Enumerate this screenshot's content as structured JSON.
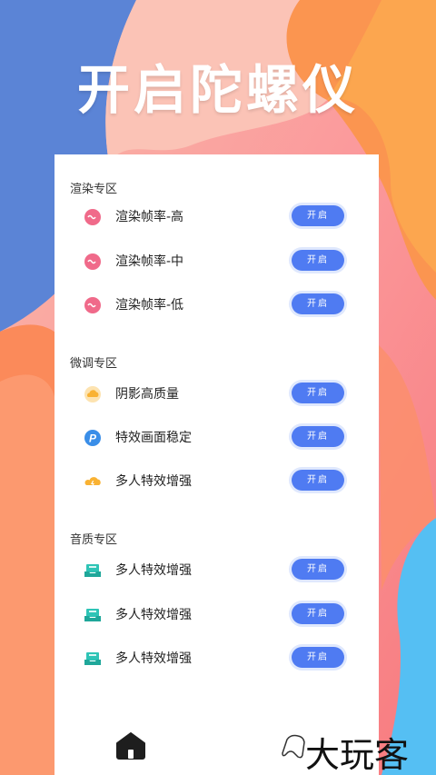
{
  "header": {
    "title": "开启陀螺仪"
  },
  "sections": [
    {
      "title": "渲染专区",
      "items": [
        {
          "label": "渲染帧率-高",
          "icon": "pink-badge-icon",
          "button": "开启"
        },
        {
          "label": "渲染帧率-中",
          "icon": "pink-badge-icon",
          "button": "开启"
        },
        {
          "label": "渲染帧率-低",
          "icon": "pink-badge-icon",
          "button": "开启"
        }
      ]
    },
    {
      "title": "微调专区",
      "items": [
        {
          "label": "阴影高质量",
          "icon": "cloud-icon",
          "button": "开启"
        },
        {
          "label": "特效画面稳定",
          "icon": "p-badge-icon",
          "button": "开启"
        },
        {
          "label": "多人特效增强",
          "icon": "storm-cloud-icon",
          "button": "开启"
        }
      ]
    },
    {
      "title": "音质专区",
      "items": [
        {
          "label": "多人特效增强",
          "icon": "inbox-icon",
          "button": "开启"
        },
        {
          "label": "多人特效增强",
          "icon": "inbox-icon",
          "button": "开启"
        },
        {
          "label": "多人特效增强",
          "icon": "inbox-icon",
          "button": "开启"
        }
      ]
    }
  ],
  "bottom_nav": {
    "icon": "home-icon"
  },
  "watermark": "大玩客",
  "colors": {
    "accent": "#4f7bf2",
    "pink": "#f06a8a",
    "teal": "#2ec4b6",
    "amber": "#f9b233"
  }
}
